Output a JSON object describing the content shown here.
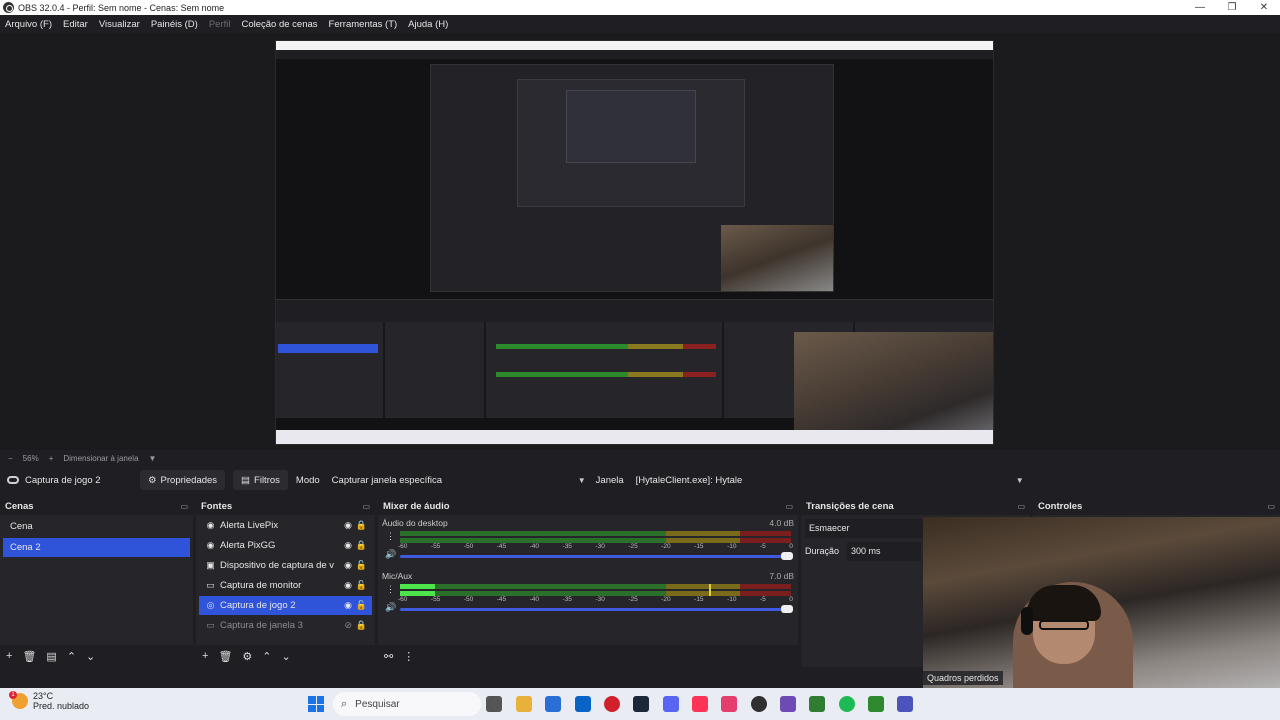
{
  "window": {
    "title": "OBS 32.0.4 - Perfil: Sem nome - Cenas: Sem nome",
    "minimize_glyph": "—",
    "maximize_glyph": "❐",
    "close_glyph": "✕"
  },
  "menu": [
    {
      "label": "Arquivo (F)",
      "disabled": false
    },
    {
      "label": "Editar",
      "disabled": false
    },
    {
      "label": "Visualizar",
      "disabled": false
    },
    {
      "label": "Painéis (D)",
      "disabled": false
    },
    {
      "label": "Perfil",
      "disabled": true
    },
    {
      "label": "Coleção de cenas",
      "disabled": false
    },
    {
      "label": "Ferramentas (T)",
      "disabled": false
    },
    {
      "label": "Ajuda (H)",
      "disabled": false
    }
  ],
  "zoom": {
    "level": "56%",
    "minus": "−",
    "plus": "+",
    "resize_label": "Dimensionar à janela",
    "arrow": "▼"
  },
  "source_toolbar": {
    "source_name": "Captura de jogo 2",
    "properties_label": "Propriedades",
    "filters_label": "Filtros",
    "mode_label": "Modo",
    "mode_value": "Capturar janela específica",
    "window_label": "Janela",
    "window_value": "[HytaleClient.exe]: Hytale"
  },
  "scenes": {
    "title": "Cenas",
    "items": [
      {
        "label": "Cena",
        "selected": false
      },
      {
        "label": "Cena 2",
        "selected": true
      }
    ]
  },
  "sources": {
    "title": "Fontes",
    "items": [
      {
        "label": "Alerta LivePix",
        "icon": "browser-icon"
      },
      {
        "label": "Alerta PixGG",
        "icon": "browser-icon"
      },
      {
        "label": "Dispositivo de captura de vídeo",
        "icon": "camera-icon"
      },
      {
        "label": "Captura de monitor",
        "icon": "monitor-icon"
      },
      {
        "label": "Captura de jogo 2",
        "icon": "gamepad-icon"
      },
      {
        "label": "Captura de janela 3",
        "icon": "window-icon"
      }
    ]
  },
  "mixer": {
    "title": "Mixer de áudio",
    "tracks": [
      {
        "name": "Áudio do desktop",
        "db": "4.0 dB",
        "level": 0.0,
        "peak": 0.0,
        "volume": 1.0
      },
      {
        "name": "Mic/Aux",
        "db": "7.0 dB",
        "level": 0.09,
        "peak": 0.79,
        "volume": 1.0
      }
    ],
    "ticks": [
      "-60",
      "-55",
      "-50",
      "-45",
      "-40",
      "-35",
      "-30",
      "-25",
      "-20",
      "-15",
      "-10",
      "-5",
      "0"
    ]
  },
  "transitions": {
    "title": "Transições de cena",
    "type_value": "Esmaecer",
    "duration_label": "Duração",
    "duration_value": "300 ms"
  },
  "controls": {
    "title": "Controles"
  },
  "status": {
    "dropped_frames": "Quadros perdidos"
  },
  "taskbar": {
    "temperature": "23°C",
    "forecast": "Pred. nublado",
    "search_placeholder": "Pesquisar",
    "notification_count": "1"
  },
  "colors": {
    "selection": "#2f53d9",
    "background": "#1f1f23",
    "dock": "#26262a"
  }
}
